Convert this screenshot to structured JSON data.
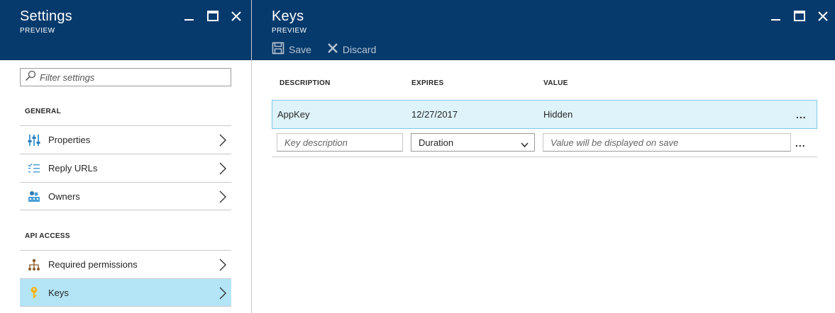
{
  "settings_blade": {
    "title": "Settings",
    "subtitle": "PREVIEW",
    "filter_placeholder": "Filter settings",
    "sections": [
      {
        "heading": "GENERAL",
        "items": [
          {
            "label": "Properties",
            "icon": "properties-icon"
          },
          {
            "label": "Reply URLs",
            "icon": "list-icon"
          },
          {
            "label": "Owners",
            "icon": "owners-icon"
          }
        ]
      },
      {
        "heading": "API ACCESS",
        "items": [
          {
            "label": "Required permissions",
            "icon": "hierarchy-icon"
          },
          {
            "label": "Keys",
            "icon": "key-icon",
            "active": true
          }
        ]
      }
    ]
  },
  "keys_blade": {
    "title": "Keys",
    "subtitle": "PREVIEW",
    "commands": {
      "save": "Save",
      "discard": "Discard"
    },
    "columns": {
      "description": "DESCRIPTION",
      "expires": "EXPIRES",
      "value": "VALUE"
    },
    "rows": [
      {
        "description": "AppKey",
        "expires": "12/27/2017",
        "value": "Hidden"
      }
    ],
    "new_row": {
      "description_placeholder": "Key description",
      "duration_selected": "Duration",
      "value_placeholder": "Value will be displayed on save"
    },
    "more_label": "..."
  },
  "colors": {
    "header_bg": "#063a6c",
    "active_item_bg": "#b3e5f7",
    "selected_row_bg": "#dff3fa",
    "selected_row_border": "#7cc8e6",
    "accent": "#0072c6"
  }
}
